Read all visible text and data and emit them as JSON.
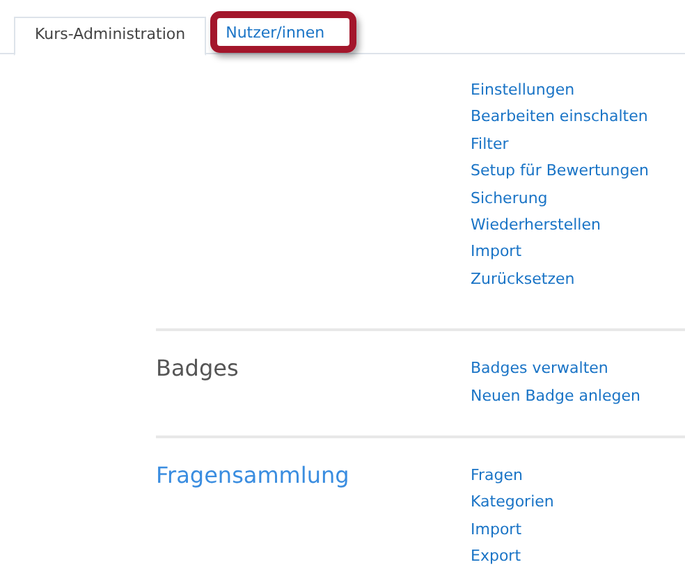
{
  "tabs": [
    {
      "label": "Kurs-Administration",
      "selected": true
    },
    {
      "label": "Nutzer/innen",
      "selected": false,
      "highlighted": true
    }
  ],
  "sections": [
    {
      "links": [
        "Einstellungen",
        "Bearbeiten einschalten",
        "Filter",
        "Setup für Bewertungen",
        "Sicherung",
        "Wiederherstellen",
        "Import",
        "Zurücksetzen"
      ]
    },
    {
      "heading": "Badges",
      "heading_is_link": false,
      "links": [
        "Badges verwalten",
        "Neuen Badge anlegen"
      ]
    },
    {
      "heading": "Fragensammlung",
      "heading_is_link": true,
      "links": [
        "Fragen",
        "Kategorien",
        "Import",
        "Export"
      ]
    }
  ]
}
